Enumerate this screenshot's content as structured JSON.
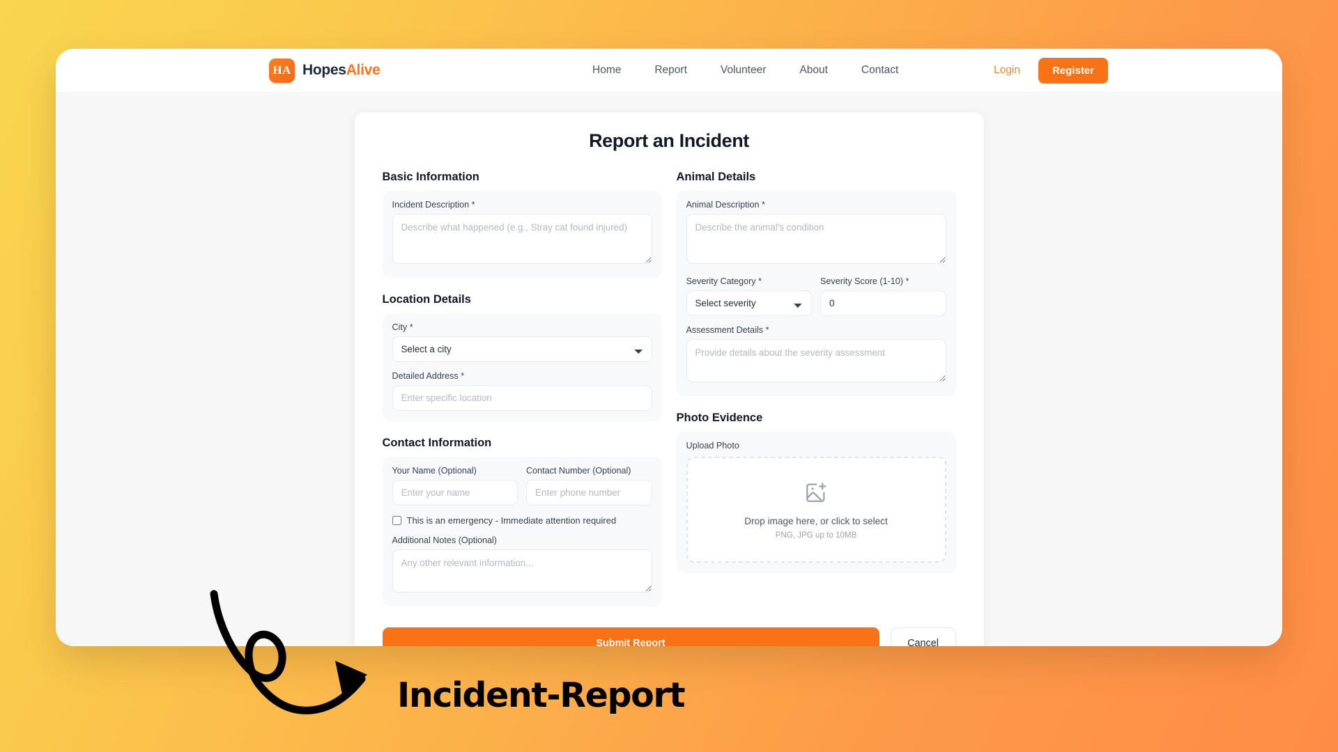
{
  "brand": {
    "mark": "HA",
    "name_part1": "Hopes",
    "name_part2": "Alive"
  },
  "nav": {
    "links": [
      {
        "label": "Home"
      },
      {
        "label": "Report"
      },
      {
        "label": "Volunteer"
      },
      {
        "label": "About"
      },
      {
        "label": "Contact"
      }
    ],
    "login_label": "Login",
    "register_label": "Register"
  },
  "form": {
    "title": "Report an Incident",
    "sections": {
      "basic": {
        "heading": "Basic Information",
        "incident_description_label": "Incident Description *",
        "incident_description_placeholder": "Describe what happened (e.g., Stray cat found injured)",
        "incident_description_value": ""
      },
      "location": {
        "heading": "Location Details",
        "city_label": "City *",
        "city_selected": "Select a city",
        "city_options": [
          "Select a city"
        ],
        "address_label": "Detailed Address *",
        "address_placeholder": "Enter specific location",
        "address_value": ""
      },
      "contact": {
        "heading": "Contact Information",
        "name_label": "Your Name (Optional)",
        "name_placeholder": "Enter your name",
        "name_value": "",
        "phone_label": "Contact Number (Optional)",
        "phone_placeholder": "Enter phone number",
        "phone_value": "",
        "emergency_label": "This is an emergency - Immediate attention required",
        "emergency_checked": false,
        "notes_label": "Additional Notes (Optional)",
        "notes_placeholder": "Any other relevant information...",
        "notes_value": ""
      },
      "animal": {
        "heading": "Animal Details",
        "animal_description_label": "Animal Description *",
        "animal_description_placeholder": "Describe the animal's condition",
        "animal_description_value": "",
        "severity_category_label": "Severity Category *",
        "severity_category_selected": "Select severity",
        "severity_category_options": [
          "Select severity"
        ],
        "severity_score_label": "Severity Score (1-10) *",
        "severity_score_value": "0",
        "assessment_label": "Assessment Details *",
        "assessment_placeholder": "Provide details about the severity assessment",
        "assessment_value": ""
      },
      "photo": {
        "heading": "Photo Evidence",
        "upload_label": "Upload Photo",
        "dropzone_main": "Drop image here, or click to select",
        "dropzone_sub": "PNG, JPG up to 10MB",
        "dropzone_icon": "image-plus-icon"
      }
    },
    "submit_label": "Submit Report",
    "cancel_label": "Cancel"
  },
  "annotation": {
    "text": "Incident-Report",
    "arrow_icon": "curly-arrow-icon"
  },
  "colors": {
    "brand_orange": "#f97316",
    "brand_navy": "#1e2939",
    "bg_yellow": "#f9d64f",
    "bg_orange": "#ff8c46",
    "page_bg": "#f7f7f8",
    "panel_bg": "#f8f9fb"
  }
}
